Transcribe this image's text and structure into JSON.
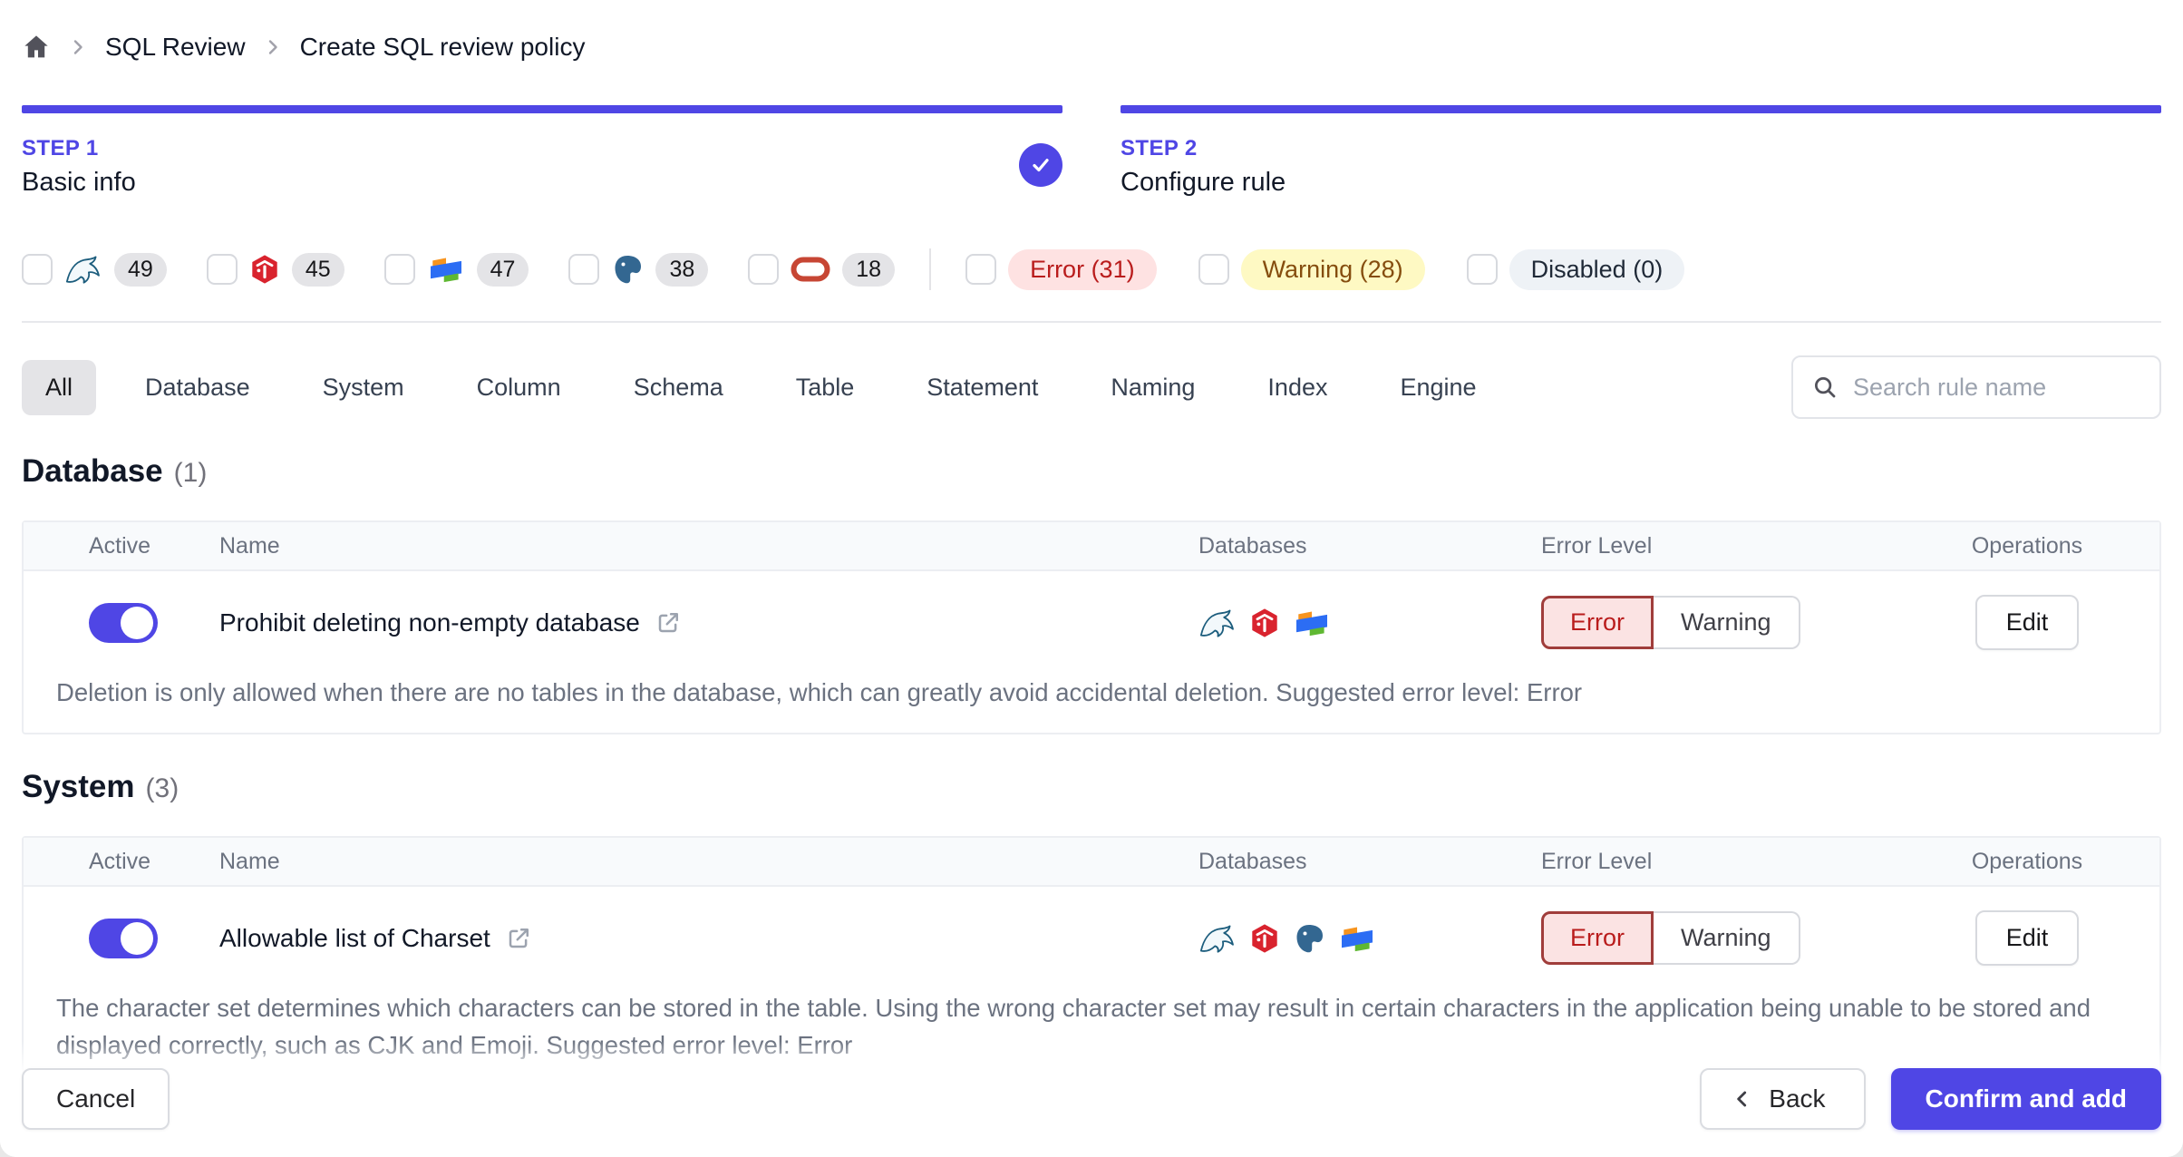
{
  "breadcrumb": {
    "items": [
      "SQL Review",
      "Create SQL review policy"
    ]
  },
  "steps": [
    {
      "label": "STEP 1",
      "title": "Basic info",
      "completed": true
    },
    {
      "label": "STEP 2",
      "title": "Configure rule",
      "completed": false
    }
  ],
  "filters": {
    "engines": [
      {
        "name": "mysql",
        "count": "49"
      },
      {
        "name": "tidb",
        "count": "45"
      },
      {
        "name": "oceanbase",
        "count": "47"
      },
      {
        "name": "postgres",
        "count": "38"
      },
      {
        "name": "oracle",
        "count": "18"
      }
    ],
    "levels": [
      {
        "label": "Error (31)",
        "type": "error"
      },
      {
        "label": "Warning (28)",
        "type": "warning"
      },
      {
        "label": "Disabled (0)",
        "type": "disabled"
      }
    ]
  },
  "tabs": {
    "items": [
      "All",
      "Database",
      "System",
      "Column",
      "Schema",
      "Table",
      "Statement",
      "Naming",
      "Index",
      "Engine"
    ],
    "active": "All"
  },
  "search": {
    "placeholder": "Search rule name"
  },
  "table_headers": {
    "active": "Active",
    "name": "Name",
    "databases": "Databases",
    "error_level": "Error Level",
    "operations": "Operations"
  },
  "sections": [
    {
      "title": "Database",
      "count": "(1)",
      "rules": [
        {
          "name": "Prohibit deleting non-empty database",
          "active": true,
          "databases": [
            "mysql",
            "tidb",
            "oceanbase"
          ],
          "level": "Error",
          "level_options": [
            "Error",
            "Warning"
          ],
          "operation": "Edit",
          "description": "Deletion is only allowed when there are no tables in the database, which can greatly avoid accidental deletion. Suggested error level: Error"
        }
      ]
    },
    {
      "title": "System",
      "count": "(3)",
      "rules": [
        {
          "name": "Allowable list of Charset",
          "active": true,
          "databases": [
            "mysql",
            "tidb",
            "postgres",
            "oceanbase"
          ],
          "level": "Error",
          "level_options": [
            "Error",
            "Warning"
          ],
          "operation": "Edit",
          "description": "The character set determines which characters can be stored in the table. Using the wrong character set may result in certain characters in the application being unable to be stored and displayed correctly, such as CJK and Emoji. Suggested error level: Error"
        }
      ]
    }
  ],
  "footer": {
    "cancel": "Cancel",
    "back": "Back",
    "confirm": "Confirm and add"
  },
  "colors": {
    "accent": "#4f46e5",
    "error_text": "#b91c1c",
    "error_bg": "#fee2e2",
    "warning_text": "#854d0e",
    "warning_bg": "#fef9c3",
    "disabled_bg": "#eef2f6"
  }
}
